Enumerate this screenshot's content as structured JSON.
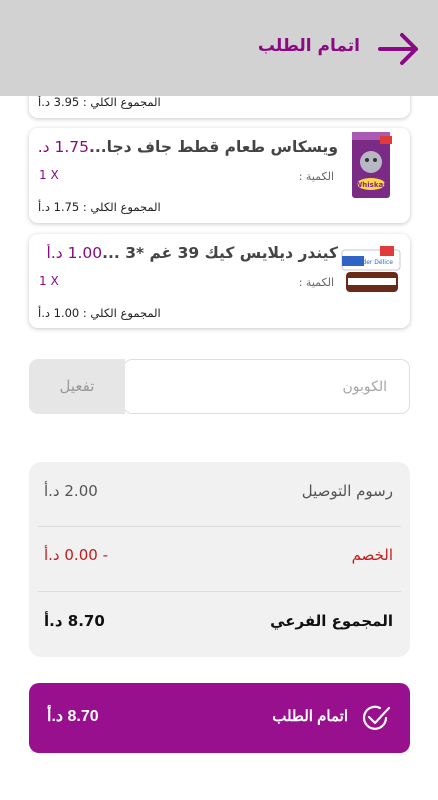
{
  "header": {
    "title": "اتمام الطلب",
    "back_icon": "arrow-right-icon"
  },
  "cart_items": [
    {
      "total_label": "المجموع الكلي : 3.95 د.أ"
    },
    {
      "name": "ويسكاس طعام قطط جاف دجا...",
      "price": "1.75 د.أ",
      "qty_label": "الكمية :",
      "qty_value": "1 X",
      "total_label": "المجموع الكلي : 1.75 د.أ",
      "image_icon": "whiskas-pack-image",
      "image_text": "Whiskas"
    },
    {
      "name": "كيندر ديلايس كيك 39 غم *3 ...",
      "price": "1.00 د.أ",
      "qty_label": "الكمية :",
      "qty_value": "1 X",
      "total_label": "المجموع الكلي : 1.00 د.أ",
      "image_icon": "kinder-delice-image",
      "image_text": "Kinder Délice"
    }
  ],
  "coupon": {
    "placeholder": "الكوبون",
    "button_label": "تفعيل"
  },
  "summary": {
    "delivery_label": "رسوم التوصيل",
    "delivery_value": "2.00 د.أ",
    "discount_label": "الخصم",
    "discount_value": "- 0.00 د.أ",
    "subtotal_label": "المجموع الفرعي",
    "subtotal_value": "8.70 د.أ"
  },
  "checkout": {
    "label": "اتمام الطلب",
    "total": "8.70 د.أ",
    "icon": "check-circle-icon"
  },
  "colors": {
    "accent": "#99108f",
    "accent_text": "#8b0a84",
    "discount": "#c41d1d",
    "header_bg": "#d2d2d2"
  }
}
